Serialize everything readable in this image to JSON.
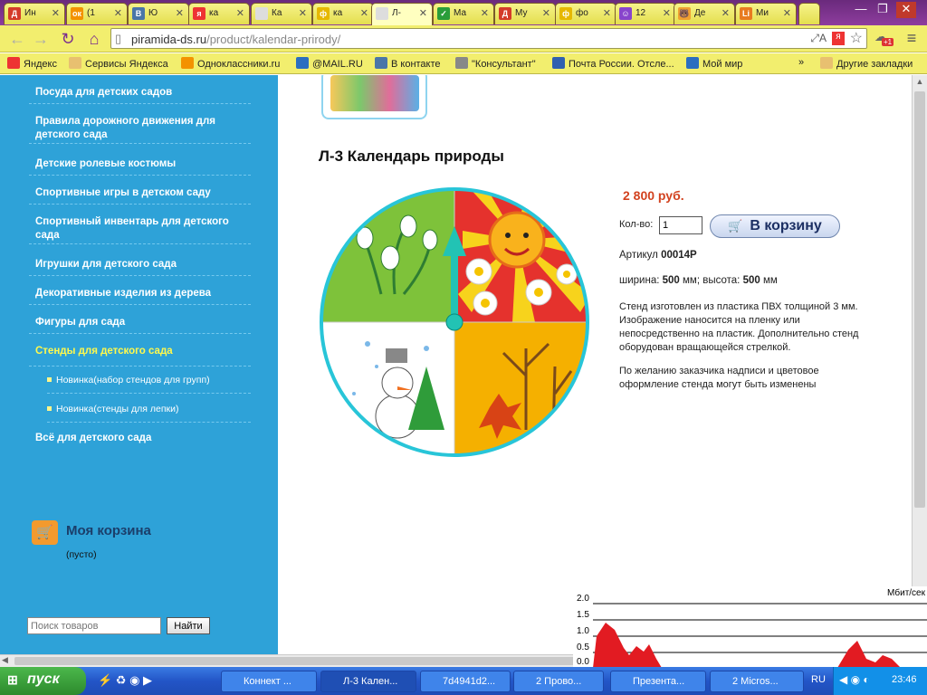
{
  "tabs": [
    {
      "label": "Ин",
      "fav": "Д",
      "color": "#d43b2a"
    },
    {
      "label": "(1",
      "fav": "ок",
      "color": "#f39200"
    },
    {
      "label": "Ю",
      "fav": "В",
      "color": "#4a76a8"
    },
    {
      "label": "ка",
      "fav": "я",
      "color": "#e33"
    },
    {
      "label": "Ка",
      "fav": "",
      "color": "#ddd"
    },
    {
      "label": "ка",
      "fav": "ф",
      "color": "#e6b800"
    },
    {
      "label": "Л-",
      "fav": "",
      "color": "#ddd"
    },
    {
      "label": "Ма",
      "fav": "✓",
      "color": "#2a9d3a"
    },
    {
      "label": "Му",
      "fav": "Д",
      "color": "#d43b2a"
    },
    {
      "label": "фо",
      "fav": "ф",
      "color": "#e6b800"
    },
    {
      "label": "12",
      "fav": "☺",
      "color": "#8844cc"
    },
    {
      "label": "Де",
      "fav": "🐻",
      "color": "#f0a030"
    },
    {
      "label": "Ми",
      "fav": "Li",
      "color": "#e87b20"
    }
  ],
  "window": {
    "minimize": "—",
    "restore": "❐",
    "close": "✕"
  },
  "address": {
    "host": "piramida-ds.ru",
    "path": "/product/kalendar-prirody/"
  },
  "bookmarks": [
    {
      "label": "Яндекс",
      "color": "#e33"
    },
    {
      "label": "Сервисы Яндекса",
      "color": "#e8c070"
    },
    {
      "label": "Одноклассники.ru",
      "color": "#f39200"
    },
    {
      "label": "@MAIL.RU",
      "color": "#2b6ec0"
    },
    {
      "label": "В контакте",
      "color": "#4a76a8"
    },
    {
      "label": "\"Консультант\"",
      "color": "#888"
    },
    {
      "label": "Почта России. Отсле...",
      "color": "#3060b0"
    },
    {
      "label": "Мой мир",
      "color": "#2b6ec0"
    }
  ],
  "bookmarks_overflow": "»",
  "other_bookmarks": "Другие закладки",
  "categories": [
    "Посуда для детских садов",
    "Правила дорожного движения для детского сада",
    "Детские ролевые костюмы",
    "Спортивные игры в детском саду",
    "Спортивный инвентарь для детского сада",
    "Игрушки для детского сада",
    "Декоративные изделия из дерева",
    "Фигуры для сада",
    "Стенды для детского сада"
  ],
  "subcategories": [
    "Новинка(набор стендов для групп)",
    "Новинка(стенды для лепки)"
  ],
  "all_link": "Всё для детского сада",
  "cart": {
    "title": "Моя корзина",
    "status": "(пусто)"
  },
  "search": {
    "placeholder": "Поиск товаров",
    "button": "Найти"
  },
  "product": {
    "title": "Л-3 Календарь природы",
    "price": "2 800 руб.",
    "qty_label": "Кол-во:",
    "qty": "1",
    "add_button": "В корзину",
    "sku_label": "Артикул",
    "sku": "00014Р",
    "width_label": "ширина:",
    "width": "500",
    "height_label": "высота:",
    "height": "500",
    "unit": "мм",
    "description": "Стенд изготовлен из пластика ПВХ толщиной 3 мм. Изображение наносится на пленку или непосредственно на пластик. Дополнительно стенд оборудован вращающейся стрелкой.",
    "note": "По желанию заказчика надписи и цветовое оформление стенда могут быть изменены"
  },
  "netmon": {
    "unit": "Мбит/сек",
    "ticks": [
      "2.0",
      "1.5",
      "1.0",
      "0.5",
      "0.0"
    ]
  },
  "taskbar": {
    "start": "пуск",
    "tasks": [
      "Коннект ...",
      "Л-3 Кален...",
      "7d4941d2...",
      "2 Прово...",
      "Презента...",
      "2 Micros..."
    ],
    "lang": "RU",
    "time": "23:46"
  }
}
